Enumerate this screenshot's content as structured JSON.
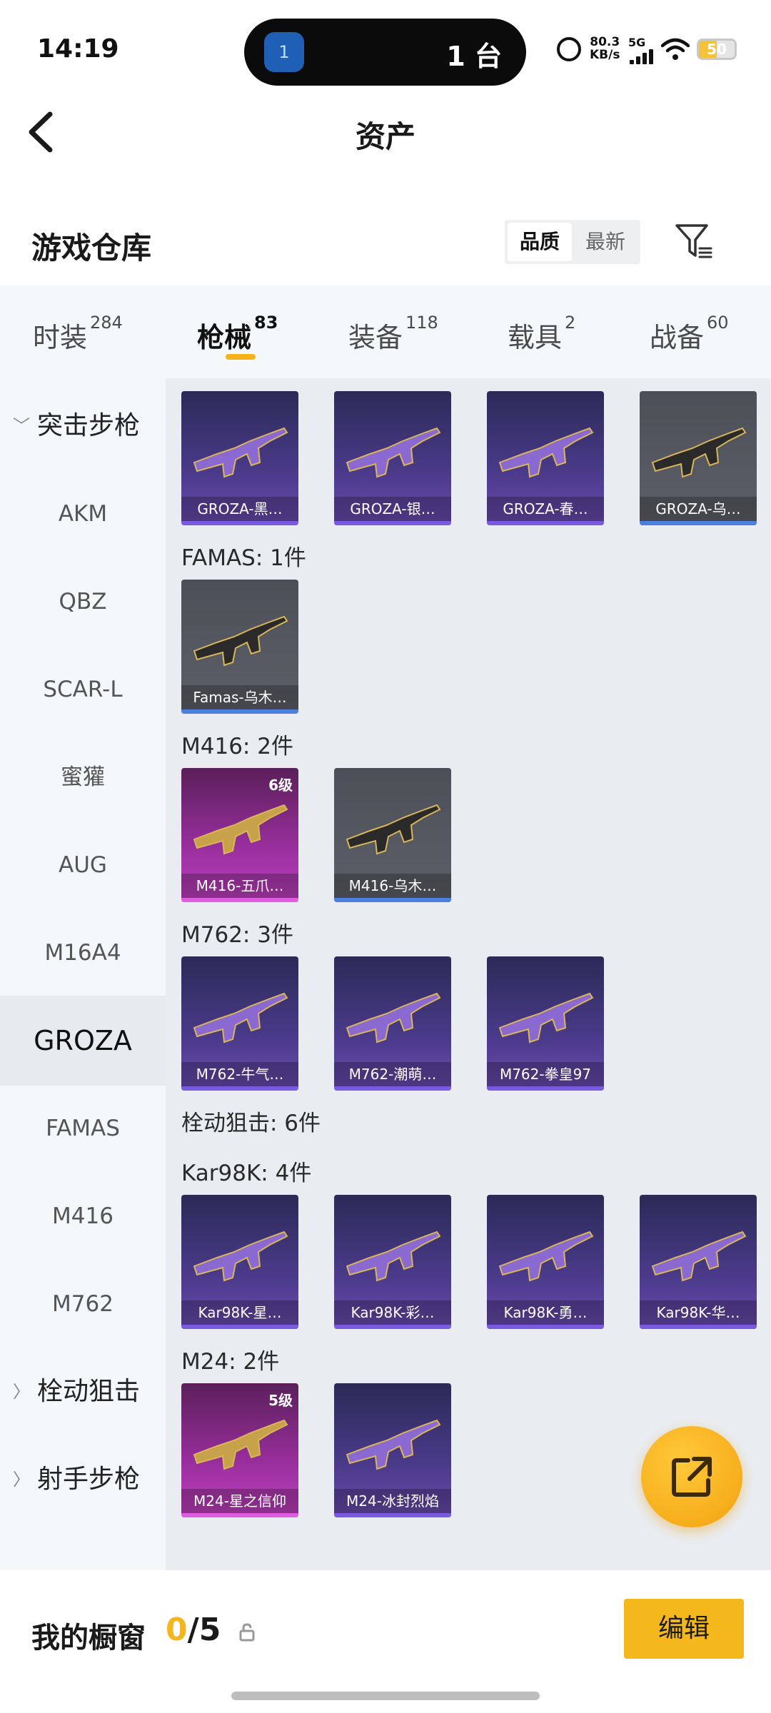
{
  "status_bar": {
    "time": "14:19",
    "island_app_badge": "1",
    "island_text": "1 台",
    "net_speed_value": "80.3",
    "net_speed_unit": "KB/s",
    "net_type": "5G",
    "battery": "50"
  },
  "header": {
    "title": "资产"
  },
  "warehouse": {
    "title": "游戏仓库",
    "sort_options": [
      "品质",
      "最新"
    ],
    "active_sort": "品质"
  },
  "tabs": [
    {
      "label": "时装",
      "count": "284"
    },
    {
      "label": "枪械",
      "count": "83"
    },
    {
      "label": "装备",
      "count": "118"
    },
    {
      "label": "载具",
      "count": "2"
    },
    {
      "label": "战备",
      "count": "60"
    }
  ],
  "active_tab": "枪械",
  "sidebar": [
    {
      "label": "突击步枪",
      "type": "group",
      "expanded": true
    },
    {
      "label": "AKM",
      "type": "item"
    },
    {
      "label": "QBZ",
      "type": "item"
    },
    {
      "label": "SCAR-L",
      "type": "item"
    },
    {
      "label": "蜜獾",
      "type": "item"
    },
    {
      "label": "AUG",
      "type": "item"
    },
    {
      "label": "M16A4",
      "type": "item"
    },
    {
      "label": "GROZA",
      "type": "item",
      "active": true
    },
    {
      "label": "FAMAS",
      "type": "item"
    },
    {
      "label": "M416",
      "type": "item"
    },
    {
      "label": "M762",
      "type": "item"
    },
    {
      "label": "栓动狙击",
      "type": "group",
      "expanded": false
    },
    {
      "label": "射手步枪",
      "type": "group",
      "expanded": false
    }
  ],
  "groups": [
    {
      "label": "",
      "cards": [
        {
          "name": "GROZA-黑…",
          "rarity": "purple"
        },
        {
          "name": "GROZA-银…",
          "rarity": "purple"
        },
        {
          "name": "GROZA-春…",
          "rarity": "purple"
        },
        {
          "name": "GROZA-乌…",
          "rarity": "gray"
        }
      ]
    },
    {
      "label": "FAMAS: 1件",
      "cards": [
        {
          "name": "Famas-乌木…",
          "rarity": "gray"
        }
      ]
    },
    {
      "label": "M416: 2件",
      "cards": [
        {
          "name": "M416-五爪…",
          "rarity": "pink",
          "level": "6级"
        },
        {
          "name": "M416-乌木…",
          "rarity": "gray"
        }
      ]
    },
    {
      "label": "M762: 3件",
      "cards": [
        {
          "name": "M762-牛气…",
          "rarity": "purple"
        },
        {
          "name": "M762-潮萌…",
          "rarity": "purple"
        },
        {
          "name": "M762-拳皇97",
          "rarity": "purple"
        }
      ]
    },
    {
      "label": "栓动狙击: 6件",
      "cards": []
    },
    {
      "label": "Kar98K: 4件",
      "cards": [
        {
          "name": "Kar98K-星…",
          "rarity": "purple"
        },
        {
          "name": "Kar98K-彩…",
          "rarity": "purple"
        },
        {
          "name": "Kar98K-勇…",
          "rarity": "purple"
        },
        {
          "name": "Kar98K-华…",
          "rarity": "purple"
        }
      ]
    },
    {
      "label": "M24: 2件",
      "cards": [
        {
          "name": "M24-星之信仰",
          "rarity": "pink",
          "level": "5级"
        },
        {
          "name": "M24-冰封烈焰",
          "rarity": "purple"
        }
      ]
    }
  ],
  "showcase": {
    "title": "我的橱窗",
    "current": "0",
    "total": "/5",
    "edit_label": "编辑"
  },
  "colors": {
    "accent": "#f5b81c",
    "purple_card": "#4a3a8a",
    "pink_card": "#9a2f9e",
    "gray_card": "#55585f"
  }
}
